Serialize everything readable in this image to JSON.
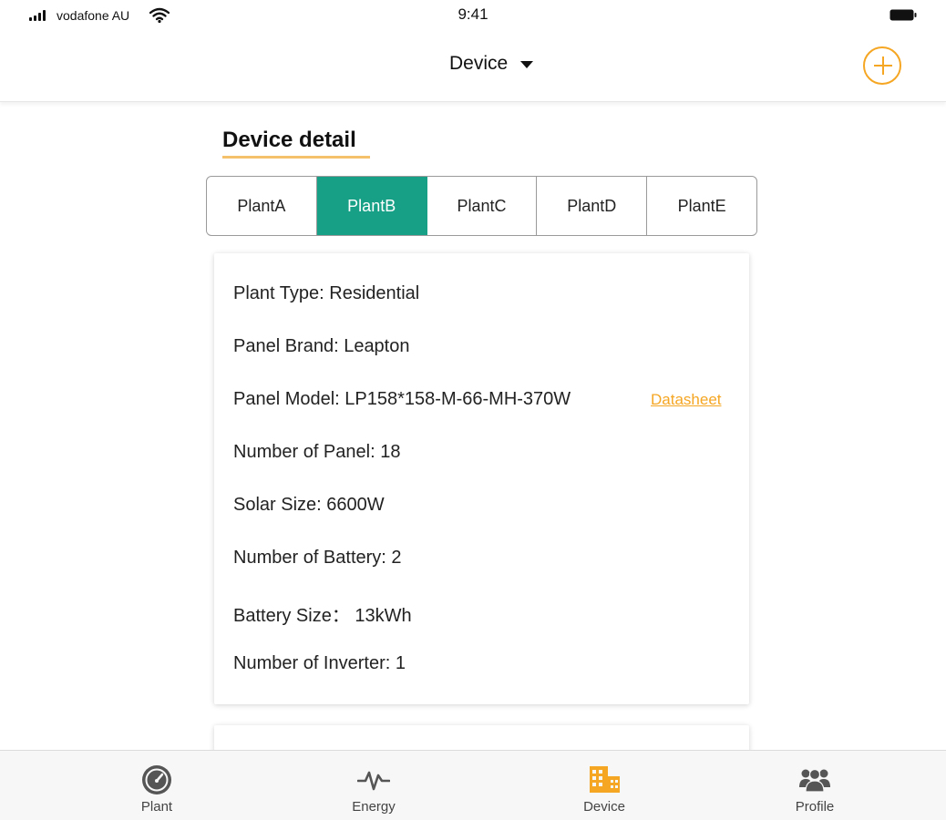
{
  "status_bar": {
    "carrier": "vodafone AU",
    "time": "9:41"
  },
  "header": {
    "title": "Device",
    "add_icon": "plus-circle-icon"
  },
  "section": {
    "title": "Device detail"
  },
  "tabs": [
    {
      "label": "PlantA",
      "active": false
    },
    {
      "label": "PlantB",
      "active": true
    },
    {
      "label": "PlantC",
      "active": false
    },
    {
      "label": "PlantD",
      "active": false
    },
    {
      "label": "PlantE",
      "active": false
    }
  ],
  "details": {
    "plant_type": "Plant Type: Residential",
    "panel_brand": "Panel Brand: Leapton",
    "panel_model": "Panel Model: LP158*158-M-66-MH-370W",
    "datasheet_link": "Datasheet",
    "number_of_panel": "Number of Panel: 18",
    "solar_size": "Solar Size: 6600W",
    "number_of_battery": "Number of Battery: 2",
    "battery_size": "Battery Size： 13kWh",
    "number_of_inverter": "Number of Inverter: 1"
  },
  "bottom_nav": [
    {
      "label": "Plant",
      "icon": "gauge-icon",
      "active": false
    },
    {
      "label": "Energy",
      "icon": "pulse-icon",
      "active": false
    },
    {
      "label": "Device",
      "icon": "grid-device-icon",
      "active": true
    },
    {
      "label": "Profile",
      "icon": "users-icon",
      "active": false
    }
  ],
  "colors": {
    "accent_orange": "#f5a623",
    "active_tab_green": "#17a085",
    "nav_icon_gray": "#555555"
  }
}
